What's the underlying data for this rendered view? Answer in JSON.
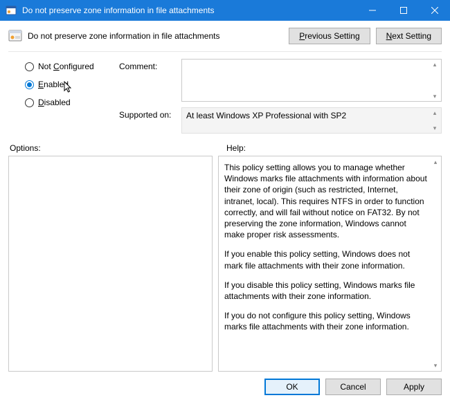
{
  "titlebar": {
    "title": "Do not preserve zone information in file attachments"
  },
  "header": {
    "title": "Do not preserve zone information in file attachments",
    "prev": "revious Setting",
    "prev_ul": "P",
    "next": "ext Setting",
    "next_ul": "N"
  },
  "state": {
    "not_configured": "Not ",
    "not_configured_ul": "C",
    "not_configured_after": "onfigured",
    "enabled_ul": "E",
    "enabled_after": "nabled",
    "disabled_ul": "D",
    "disabled_after": "isabled",
    "selected": "enabled"
  },
  "fields": {
    "comment_label": "Comment:",
    "comment_value": "",
    "supported_label": "Supported on:",
    "supported_value": "At least Windows XP Professional with SP2"
  },
  "panes": {
    "options_label": "Options:",
    "help_label": "Help:",
    "help_p1": "This policy setting allows you to manage whether Windows marks file attachments with information about their zone of origin (such as restricted, Internet, intranet, local). This requires NTFS in order to function correctly, and will fail without notice on FAT32. By not preserving the zone information, Windows cannot make proper risk assessments.",
    "help_p2": "If you enable this policy setting, Windows does not mark file attachments with their zone information.",
    "help_p3": "If you disable this policy setting, Windows marks file attachments with their zone information.",
    "help_p4": "If you do not configure this policy setting, Windows marks file attachments with their zone information."
  },
  "footer": {
    "ok": "OK",
    "cancel": "Cancel",
    "apply_ul": "A",
    "apply_after": "pply"
  }
}
